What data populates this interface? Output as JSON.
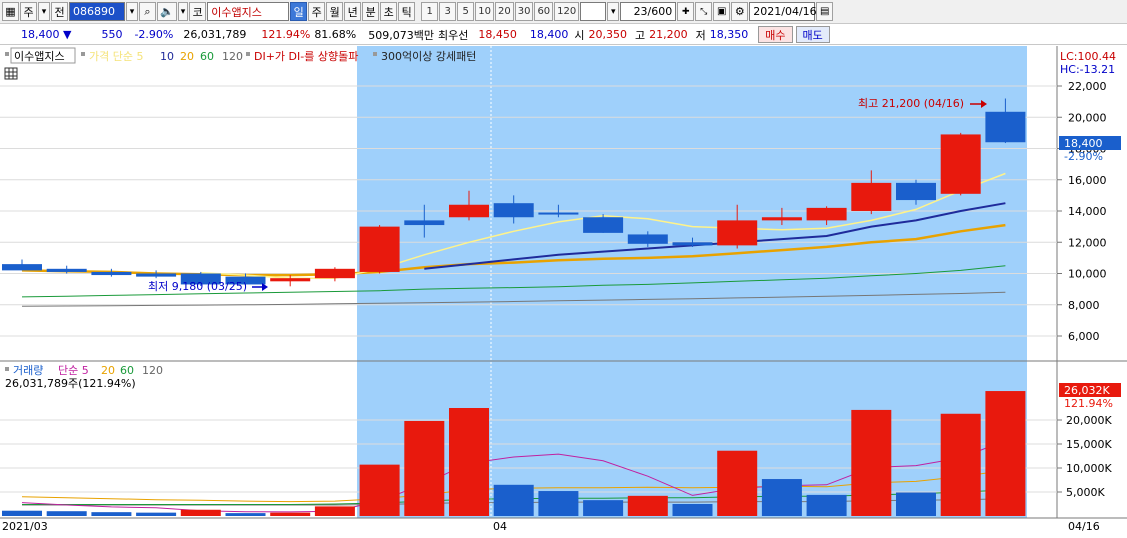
{
  "toolbar": {
    "market_label": "주",
    "market_dropdown": "▾",
    "prev_label": "전",
    "code": "086890",
    "code_dropdown": "▾",
    "name_prefix": "코",
    "name": "이수앱지스",
    "periods": [
      "일",
      "주",
      "월",
      "년",
      "분",
      "초",
      "틱"
    ],
    "active_period": "일",
    "minute_options": [
      "1",
      "3",
      "5",
      "10",
      "20",
      "30",
      "60",
      "120"
    ],
    "count": "23/600",
    "date": "2021/04/16"
  },
  "infobar": {
    "price": "18,400 ▼",
    "change": "550",
    "change_pct": "-2.90%",
    "volume": "26,031,789",
    "vol_ratio": "121.94%",
    "ratio2": "81.68%",
    "amount": "509,073백만",
    "best_ask_label": "최우선",
    "best_ask": "18,450",
    "best_bid": "18,400",
    "open_label": "시",
    "open": "20,350",
    "high_label": "고",
    "high": "21,200",
    "low_label": "저",
    "low": "18,350",
    "buy_label": "매수",
    "sell_label": "매도"
  },
  "price_panel": {
    "title": "이수앱지스",
    "ma_label": "가격 단순 5",
    "ma_periods": [
      "10",
      "20",
      "60",
      "120"
    ],
    "signal1": "DI+가 DI-를 상향돌파",
    "signal2": "300억이상 강세패턴",
    "lc": "LC:100.44",
    "hc": "HC:-13.21",
    "max_label": "최고 21,200 (04/16)",
    "min_label": "최저 9,180 (03/25)",
    "last_price": "18,400",
    "last_pct": "-2.90%",
    "y_ticks": [
      "22,000",
      "20,000",
      "18,000",
      "16,000",
      "14,000",
      "12,000",
      "10,000",
      "8,000",
      "6,000"
    ]
  },
  "volume_panel": {
    "title": "거래량",
    "ma_label": "단순 5",
    "ma_periods": [
      "20",
      "60",
      "120"
    ],
    "volume_text": "26,031,789주(121.94%)",
    "last_volume": "26,032K",
    "last_pct": "121.94%",
    "y_ticks": [
      "20,000K",
      "15,000K",
      "10,000K",
      "5,000K"
    ]
  },
  "xaxis": {
    "labels": [
      "2021/03",
      "04",
      "04/16"
    ]
  },
  "colors": {
    "up": "#e8190d",
    "down": "#1a5fcc",
    "selection": "#9fd0fb"
  },
  "chart_data": [
    {
      "type": "candlestick",
      "title": "이수앱지스",
      "ylim": [
        5000,
        23000
      ],
      "candles": [
        {
          "o": 10600,
          "h": 10900,
          "l": 10200,
          "c": 10200
        },
        {
          "o": 10300,
          "h": 10500,
          "l": 10000,
          "c": 10100
        },
        {
          "o": 10100,
          "h": 10300,
          "l": 9800,
          "c": 9900
        },
        {
          "o": 10000,
          "h": 10200,
          "l": 9700,
          "c": 9800
        },
        {
          "o": 10000,
          "h": 10100,
          "l": 9200,
          "c": 9300
        },
        {
          "o": 9800,
          "h": 10000,
          "l": 9200,
          "c": 9300
        },
        {
          "o": 9500,
          "h": 9900,
          "l": 9180,
          "c": 9700
        },
        {
          "o": 9700,
          "h": 10400,
          "l": 9500,
          "c": 10300
        },
        {
          "o": 10100,
          "h": 13100,
          "l": 10000,
          "c": 13000
        },
        {
          "o": 13400,
          "h": 14400,
          "l": 12300,
          "c": 13100
        },
        {
          "o": 13600,
          "h": 15300,
          "l": 13400,
          "c": 14400
        },
        {
          "o": 14500,
          "h": 15000,
          "l": 13200,
          "c": 13600
        },
        {
          "o": 13900,
          "h": 14400,
          "l": 13600,
          "c": 13800
        },
        {
          "o": 13600,
          "h": 13800,
          "l": 12600,
          "c": 12600
        },
        {
          "o": 12500,
          "h": 12700,
          "l": 11700,
          "c": 11900
        },
        {
          "o": 12000,
          "h": 12300,
          "l": 11700,
          "c": 11800
        },
        {
          "o": 11800,
          "h": 14400,
          "l": 11600,
          "c": 13400
        },
        {
          "o": 13400,
          "h": 14200,
          "l": 13100,
          "c": 13600
        },
        {
          "o": 13400,
          "h": 14300,
          "l": 13100,
          "c": 14200
        },
        {
          "o": 14000,
          "h": 16600,
          "l": 13800,
          "c": 15800
        },
        {
          "o": 15800,
          "h": 16000,
          "l": 14400,
          "c": 14700
        },
        {
          "o": 15100,
          "h": 19000,
          "l": 15000,
          "c": 18900
        },
        {
          "o": 20350,
          "h": 21200,
          "l": 18350,
          "c": 18400
        }
      ],
      "ma5": [
        null,
        null,
        null,
        null,
        10050,
        9900,
        9700,
        9700,
        10300,
        11200,
        12000,
        12700,
        13300,
        13700,
        13500,
        13000,
        12900,
        12800,
        12900,
        13400,
        14100,
        15300,
        16400
      ],
      "ma10": [
        null,
        null,
        null,
        null,
        null,
        null,
        null,
        null,
        null,
        10300,
        10600,
        10900,
        11200,
        11400,
        11600,
        11800,
        12000,
        12200,
        12400,
        13000,
        13400,
        14000,
        14500
      ],
      "ma20": [
        10200,
        10150,
        10100,
        10000,
        9950,
        9900,
        9900,
        9950,
        10100,
        10400,
        10600,
        10700,
        10850,
        10950,
        11000,
        11100,
        11300,
        11500,
        11700,
        12000,
        12200,
        12700,
        13100
      ],
      "ma60": [
        8500,
        8550,
        8600,
        8650,
        8700,
        8750,
        8800,
        8850,
        8900,
        9000,
        9050,
        9100,
        9150,
        9250,
        9300,
        9400,
        9500,
        9600,
        9700,
        9850,
        10000,
        10200,
        10500
      ],
      "ma120": [
        7900,
        7920,
        7940,
        7960,
        7980,
        8000,
        8020,
        8060,
        8090,
        8130,
        8170,
        8210,
        8250,
        8300,
        8340,
        8390,
        8440,
        8490,
        8540,
        8600,
        8660,
        8720,
        8800
      ]
    },
    {
      "type": "bar",
      "title": "거래량",
      "ylim": [
        0,
        25000
      ],
      "values_k": [
        1100,
        1000,
        800,
        700,
        1300,
        600,
        700,
        2000,
        10700,
        19800,
        22500,
        6500,
        5200,
        3300,
        4200,
        2500,
        13600,
        7700,
        4400,
        22100,
        4900,
        21300,
        26032
      ],
      "up": [
        false,
        false,
        false,
        false,
        true,
        false,
        true,
        true,
        true,
        true,
        true,
        false,
        false,
        false,
        true,
        false,
        true,
        false,
        false,
        true,
        false,
        true,
        true
      ],
      "ma5": [
        2800,
        2300,
        1900,
        1700,
        1100,
        900,
        850,
        1000,
        3100,
        6700,
        11000,
        12300,
        12900,
        11500,
        8300,
        4300,
        5800,
        6300,
        6500,
        10100,
        10500,
        12100,
        15700
      ],
      "ma20": [
        4000,
        3800,
        3600,
        3400,
        3300,
        3100,
        3000,
        3100,
        3600,
        4400,
        5500,
        5800,
        5900,
        5900,
        6000,
        5900,
        6000,
        6200,
        6100,
        6900,
        7200,
        8200,
        9500
      ],
      "ma60": [
        2400,
        2400,
        2400,
        2400,
        2400,
        2400,
        2400,
        2500,
        2700,
        3100,
        3500,
        3600,
        3700,
        3700,
        3800,
        3800,
        4000,
        4100,
        4100,
        4400,
        4600,
        5000,
        5400
      ],
      "ma120": [
        2300,
        2300,
        2300,
        2300,
        2300,
        2300,
        2300,
        2300,
        2400,
        2600,
        2800,
        2800,
        2900,
        2900,
        2900,
        2900,
        3000,
        3000,
        3000,
        3200,
        3300,
        3400,
        3600
      ]
    }
  ]
}
